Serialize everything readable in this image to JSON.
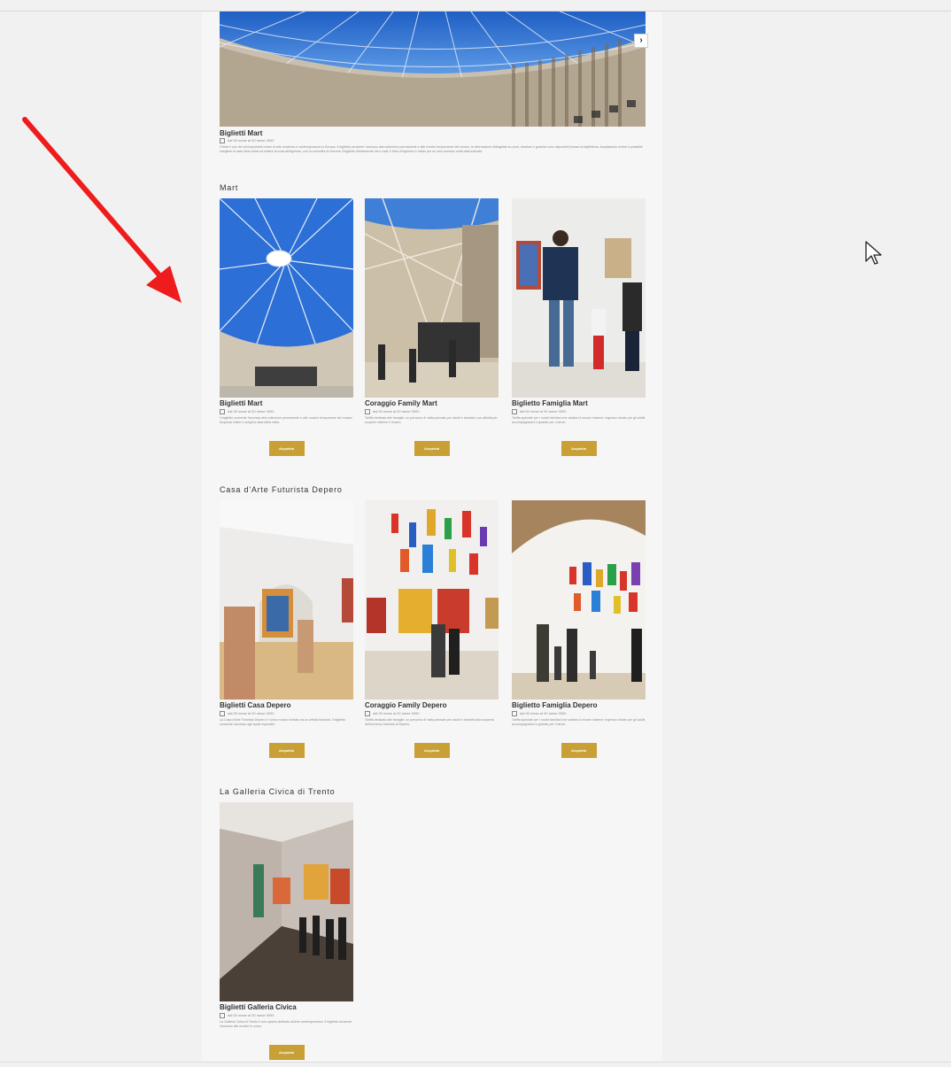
{
  "hero": {
    "next_label": "›",
    "title": "Biglietti Mart",
    "date": "dal 00 mese al 00 mese 0000",
    "description": "Il Mart è uno dei più importanti musei di arte moderna e contemporanea in Europa. Il biglietto consente l'accesso alla collezione permanente e alle mostre temporanee del museo; le informazioni dettagliate su orari, riduzioni e gratuità sono disponibili presso la biglietteria. Acquistando online è possibile scegliere la data della visita ed evitare la coda all'ingresso, con la comodità di ricevere il biglietto direttamente via e-mail; il titolo d'ingresso è valido per un solo accesso nella data indicata."
  },
  "sections": [
    {
      "title": "Mart",
      "cards": [
        {
          "title": "Biglietti Mart",
          "date": "dal 00 mese al 00 mese 0000",
          "description": "Il biglietto consente l'accesso alla collezione permanente e alle mostre temporanee del museo. Acquista online e scegli la data della visita.",
          "button": "Acquista"
        },
        {
          "title": "Coraggio Family Mart",
          "date": "dal 00 mese al 00 mese 0000",
          "description": "Tariffa dedicata alle famiglie: un percorso di visita pensato per adulti e bambini, con attività per scoprire insieme il museo.",
          "button": "Acquista"
        },
        {
          "title": "Biglietto Famiglia Mart",
          "date": "dal 00 mese al 00 mese 0000",
          "description": "Tariffa speciale per i nuclei familiari che visitano il museo insieme: ingresso ridotto per gli adulti accompagnatori e gratuito per i minori.",
          "button": "Acquista"
        }
      ]
    },
    {
      "title": "Casa d'Arte Futurista Depero",
      "cards": [
        {
          "title": "Biglietti Casa Depero",
          "date": "dal 00 mese al 00 mese 0000",
          "description": "La Casa d'Arte Futurista Depero è l'unico museo fondato da un artista futurista. Il biglietto consente l'accesso agli spazi espositivi.",
          "button": "Acquista"
        },
        {
          "title": "Coraggio Family Depero",
          "date": "dal 00 mese al 00 mese 0000",
          "description": "Tariffa dedicata alle famiglie: un percorso di visita pensato per adulti e bambini alla scoperta dell'universo futurista di Depero.",
          "button": "Acquista"
        },
        {
          "title": "Biglietto Famiglia Depero",
          "date": "dal 00 mese al 00 mese 0000",
          "description": "Tariffa speciale per i nuclei familiari che visitano il museo insieme: ingresso ridotto per gli adulti accompagnatori e gratuito per i minori.",
          "button": "Acquista"
        }
      ]
    },
    {
      "title": "La Galleria Civica di Trento",
      "cards": [
        {
          "title": "Biglietti Galleria Civica",
          "date": "dal 00 mese al 00 mese 0000",
          "description": "La Galleria Civica di Trento è uno spazio dedicato all'arte contemporanea. Il biglietto consente l'accesso alle mostre in corso.",
          "button": "Acquista"
        }
      ]
    }
  ],
  "colors": {
    "button": "#c8a035",
    "annotation_arrow": "#ee1c1c"
  },
  "icons": [
    "chevron-right-icon",
    "calendar-icon",
    "mouse-cursor-icon",
    "annotation-arrow-icon"
  ]
}
